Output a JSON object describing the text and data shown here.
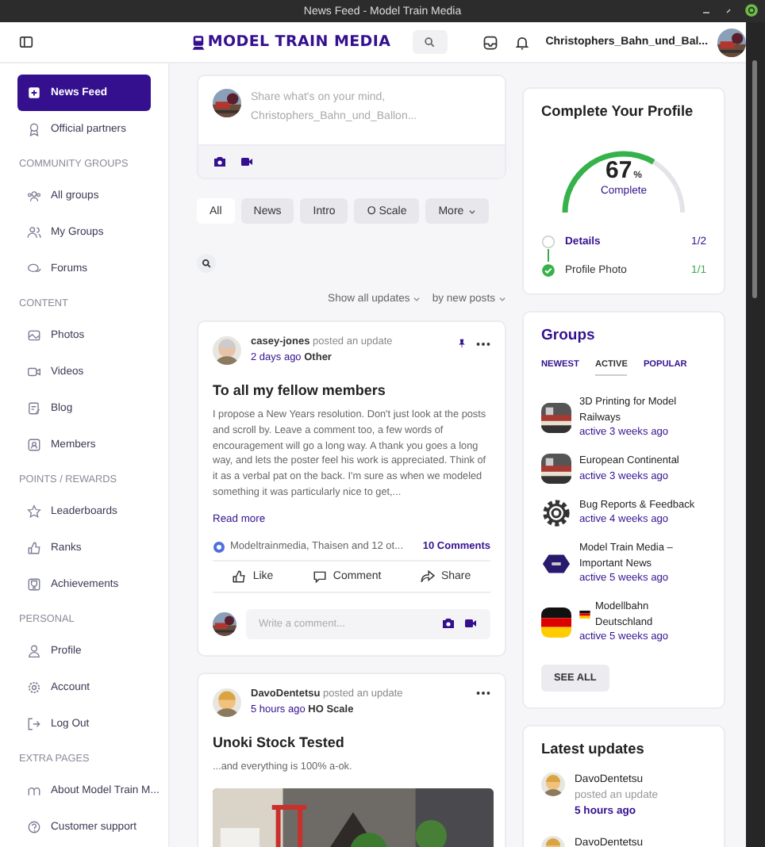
{
  "window": {
    "title": "News Feed - Model Train Media"
  },
  "header": {
    "logo": "MODEL TRAIN MEDIA",
    "username": "Christophers_Bahn_und_Bal..."
  },
  "sidebar": {
    "sections": [
      {
        "items": [
          {
            "label": "News Feed",
            "selected": true
          },
          {
            "label": "Official partners",
            "selected": false
          }
        ]
      },
      {
        "heading": "COMMUNITY GROUPS",
        "items": [
          {
            "label": "All groups",
            "selected": false
          },
          {
            "label": "My Groups",
            "selected": false
          },
          {
            "label": "Forums",
            "selected": false
          }
        ]
      },
      {
        "heading": "CONTENT",
        "items": [
          {
            "label": "Photos",
            "selected": false
          },
          {
            "label": "Videos",
            "selected": false
          },
          {
            "label": "Blog",
            "selected": false
          },
          {
            "label": "Members",
            "selected": false
          }
        ]
      },
      {
        "heading": "POINTS / REWARDS",
        "items": [
          {
            "label": "Leaderboards",
            "selected": false
          },
          {
            "label": "Ranks",
            "selected": false
          },
          {
            "label": "Achievements",
            "selected": false
          }
        ]
      },
      {
        "heading": "PERSONAL",
        "items": [
          {
            "label": "Profile",
            "selected": false
          },
          {
            "label": "Account",
            "selected": false
          },
          {
            "label": "Log Out",
            "selected": false
          }
        ]
      },
      {
        "heading": "EXTRA PAGES",
        "items": [
          {
            "label": "About Model Train M...",
            "selected": false
          },
          {
            "label": "Customer support",
            "selected": false
          }
        ]
      }
    ]
  },
  "composer": {
    "placeholder": "Share what's on your mind, Christophers_Bahn_und_Ballon..."
  },
  "filters": [
    {
      "label": "All",
      "selected": true
    },
    {
      "label": "News",
      "selected": false
    },
    {
      "label": "Intro",
      "selected": false
    },
    {
      "label": "O Scale",
      "selected": false
    },
    {
      "label": "More",
      "selected": false,
      "dropdown": true
    }
  ],
  "sort": {
    "show": "Show all updates",
    "order": "by new posts"
  },
  "posts": [
    {
      "author": "casey-jones",
      "action": "posted an update",
      "time": "2 days ago",
      "group": "Other",
      "pinned": true,
      "title": "To all my fellow members",
      "body": "I propose a New Years resolution. Don't just look at the posts and scroll by. Leave a comment too, a few words of encouragement will go a long way. A thank you goes a long way, and lets the poster feel his work is appreciated. Think of it as a verbal pat on the back. I'm sure as when we modeled something it was particularly nice to get,...",
      "read_more": "Read more",
      "reactions": "Modeltrainmedia, Thaisen and 12 ot...",
      "comments": "10 Comments",
      "actions": [
        "Like",
        "Comment",
        "Share"
      ],
      "comment_placeholder": "Write a comment..."
    },
    {
      "author": "DavoDentetsu",
      "action": "posted an update",
      "time": "5 hours ago",
      "group": "HO Scale",
      "pinned": false,
      "title": "Unoki Stock Tested",
      "body": "...and everything is 100% a-ok."
    }
  ],
  "profile": {
    "title": "Complete Your Profile",
    "percent": "67",
    "percent_sign": "%",
    "caption": "Complete",
    "steps": [
      {
        "label": "Details",
        "count": "1/2",
        "done": false
      },
      {
        "label": "Profile Photo",
        "count": "1/1",
        "done": true
      }
    ]
  },
  "groups": {
    "title": "Groups",
    "tabs": [
      {
        "label": "NEWEST",
        "selected": false
      },
      {
        "label": "ACTIVE",
        "selected": true
      },
      {
        "label": "POPULAR",
        "selected": false
      }
    ],
    "items": [
      {
        "name": "3D Printing for Model Railways",
        "activity": "active 3 weeks ago"
      },
      {
        "name": "European Continental",
        "activity": "active 3 weeks ago"
      },
      {
        "name": "Bug Reports & Feedback",
        "activity": "active 4 weeks ago",
        "kind": "gear"
      },
      {
        "name": "Model Train Media – Important News",
        "activity": "active 5 weeks ago",
        "kind": "badge"
      },
      {
        "name": "Modellbahn Deutschland",
        "activity": "active 5 weeks ago",
        "kind": "flag"
      }
    ],
    "see_all": "SEE ALL"
  },
  "latest": {
    "title": "Latest updates",
    "items": [
      {
        "author": "DavoDentetsu",
        "action": "posted an update",
        "time": "5 hours ago"
      },
      {
        "author": "DavoDentetsu"
      }
    ]
  }
}
